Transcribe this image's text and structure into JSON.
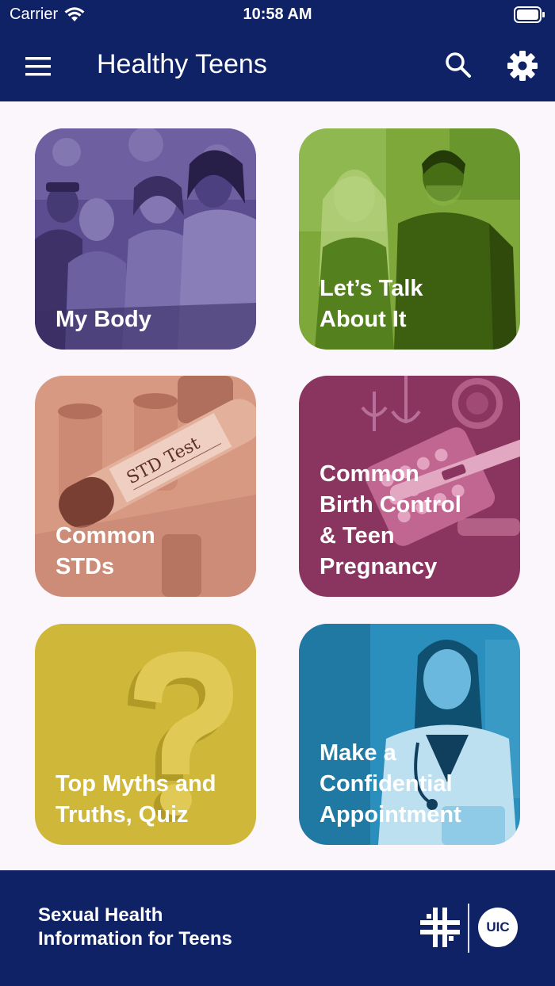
{
  "status_bar": {
    "carrier": "Carrier",
    "time": "10:58 AM"
  },
  "header": {
    "title": "Healthy Teens",
    "menu_icon": "hamburger-menu-icon",
    "search_icon": "search-icon",
    "settings_icon": "gear-icon"
  },
  "tiles": [
    {
      "label": "My Body",
      "color": "#5b4d8f"
    },
    {
      "label": "Let’s Talk\nAbout It",
      "color": "#7ea83a"
    },
    {
      "label": "Common\nSTDs",
      "color": "#d89982"
    },
    {
      "label": "Common\nBirth Control\n& Teen\nPregnancy",
      "color": "#8a3560"
    },
    {
      "label": "Top Myths and\nTruths, Quiz",
      "color": "#c9b02e"
    },
    {
      "label": "Make a\nConfidential\nAppointment",
      "color": "#2a8fbd"
    }
  ],
  "footer": {
    "tagline": "Sexual Health\nInformation for Teens",
    "logo_text": "UIC"
  },
  "colors": {
    "brand_navy": "#0f2266",
    "page_bg": "#fbf5fc"
  }
}
